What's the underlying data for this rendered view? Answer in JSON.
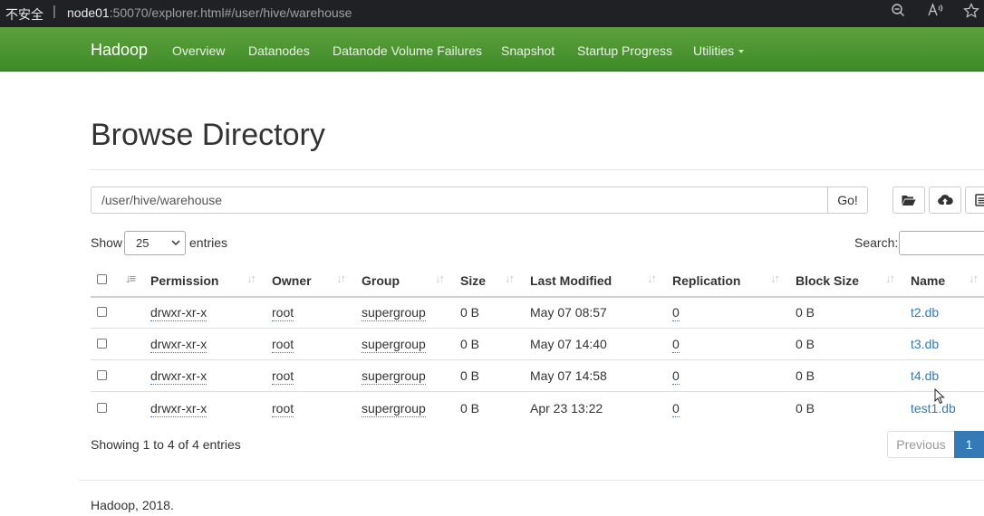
{
  "browser": {
    "security": "不安全",
    "separator": "|",
    "url_host": "node01",
    "url_rest": ":50070/explorer.html#/user/hive/warehouse",
    "icons": [
      "zoom-out-icon",
      "read-aloud-icon",
      "favorite-star-icon"
    ]
  },
  "navbar": {
    "brand": "Hadoop",
    "items": [
      "Overview",
      "Datanodes",
      "Datanode Volume Failures",
      "Snapshot",
      "Startup Progress",
      "Utilities"
    ],
    "color": "#4e9a31"
  },
  "page": {
    "title": "Browse Directory",
    "path": "/user/hive/warehouse",
    "go_label": "Go!",
    "tool_icons": [
      "folder-open-icon",
      "cloud-upload-icon",
      "list-icon"
    ]
  },
  "table_controls": {
    "show_label": "Show",
    "page_size": "25",
    "entries_label": "entries",
    "search_label": "Search:",
    "search_value": ""
  },
  "table": {
    "columns": [
      "Permission",
      "Owner",
      "Group",
      "Size",
      "Last Modified",
      "Replication",
      "Block Size",
      "Name"
    ],
    "rows": [
      {
        "permission": "drwxr-xr-x",
        "owner": "root",
        "group": "supergroup",
        "size": "0 B",
        "modified": "May 07 08:57",
        "replication": "0",
        "block_size": "0 B",
        "name": "t2.db"
      },
      {
        "permission": "drwxr-xr-x",
        "owner": "root",
        "group": "supergroup",
        "size": "0 B",
        "modified": "May 07 14:40",
        "replication": "0",
        "block_size": "0 B",
        "name": "t3.db"
      },
      {
        "permission": "drwxr-xr-x",
        "owner": "root",
        "group": "supergroup",
        "size": "0 B",
        "modified": "May 07 14:58",
        "replication": "0",
        "block_size": "0 B",
        "name": "t4.db"
      },
      {
        "permission": "drwxr-xr-x",
        "owner": "root",
        "group": "supergroup",
        "size": "0 B",
        "modified": "Apr 23 13:22",
        "replication": "0",
        "block_size": "0 B",
        "name": "test1.db"
      }
    ]
  },
  "pagination": {
    "info": "Showing 1 to 4 of 4 entries",
    "previous": "Previous",
    "current_page": "1"
  },
  "footer": {
    "text": "Hadoop, 2018."
  },
  "colors": {
    "link": "#337ab7",
    "active_page": "#337ab7",
    "browser_bar": "#202124"
  }
}
